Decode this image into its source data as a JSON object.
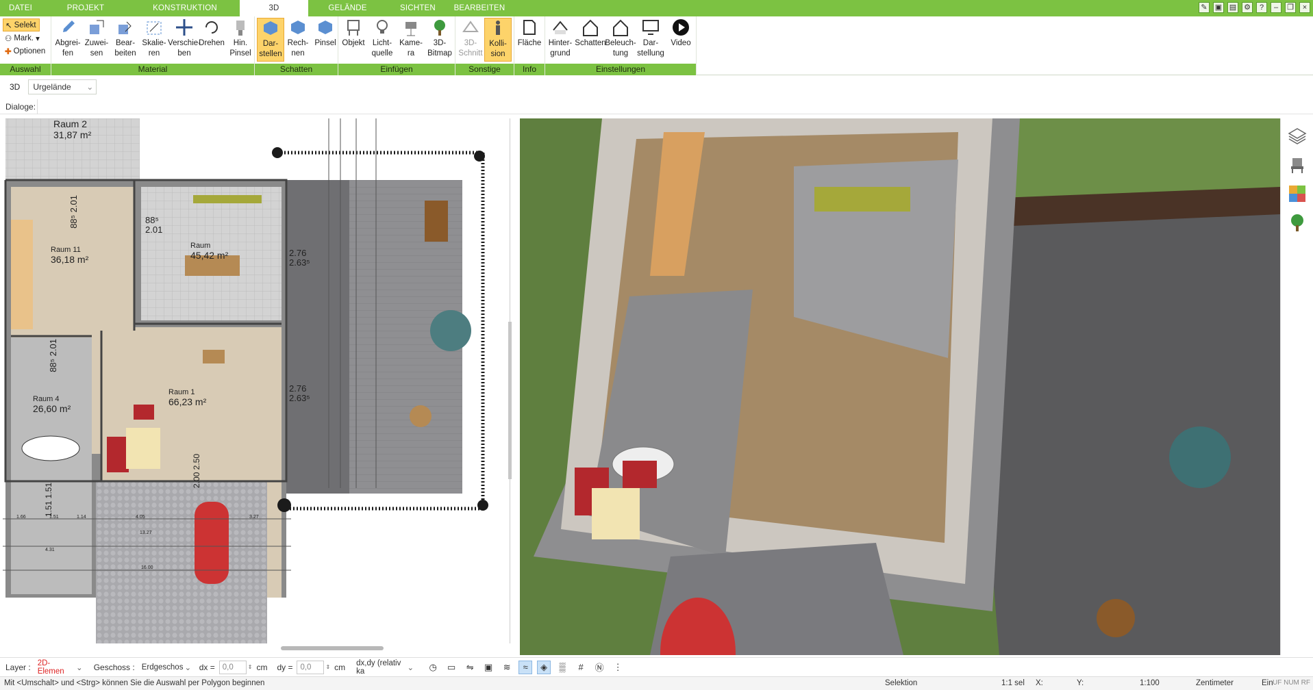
{
  "menu": {
    "tabs": [
      "DATEI",
      "PROJEKT",
      "KONSTRUKTION",
      "3D",
      "GELÄNDE",
      "SICHTEN",
      "BEARBEITEN"
    ],
    "active": "3D"
  },
  "ribbon": {
    "auswahl": {
      "label": "Auswahl",
      "selekt": "Selekt",
      "mark": "Mark.",
      "optionen": "Optionen"
    },
    "material": {
      "label": "Material",
      "buttons": [
        "Abgrei-\nfen",
        "Zuwei-\nsen",
        "Bear-\nbeiten",
        "Skalie-\nren",
        "Verschie-\nben",
        "Drehen",
        "Hin.\nPinsel"
      ]
    },
    "schatten": {
      "label": "Schatten",
      "buttons": [
        "Dar-\nstellen",
        "Rech-\nnen",
        "Pinsel"
      ]
    },
    "einfuegen": {
      "label": "Einfügen",
      "buttons": [
        "Objekt",
        "Licht-\nquelle",
        "Kame-\nra",
        "3D-\nBitmap"
      ]
    },
    "sonstige": {
      "label": "Sonstige",
      "buttons": [
        "3D-\nSchnitt",
        "Kolli-\nsion"
      ]
    },
    "info": {
      "label": "Info",
      "buttons": [
        "Fläche"
      ]
    },
    "einstellungen": {
      "label": "Einstellungen",
      "buttons": [
        "Hinter-\ngrund",
        "Schatten",
        "Beleuch-\ntung",
        "Dar-\nstellung",
        "Video"
      ]
    }
  },
  "toolbar": {
    "mode": "3D",
    "terrain": "Urgelände",
    "dialoge": "Dialoge:"
  },
  "plan": {
    "rooms": [
      {
        "name": "Raum 2",
        "area": "31,87 m²"
      },
      {
        "name": "Raum 11",
        "area": "36,18 m²"
      },
      {
        "name": "Raum",
        "area": "45,42 m²"
      },
      {
        "name": "Raum 4",
        "area": "26,60 m²"
      },
      {
        "name": "Raum 1",
        "area": "66,23 m²"
      }
    ],
    "dims": [
      "88⁵",
      "2.01",
      "88⁵",
      "2.01",
      "2.76",
      "2.63⁵",
      "88⁵",
      "2.01",
      "2.76",
      "2.63⁵",
      "2.00",
      "2.50",
      "1.51",
      "1.51"
    ],
    "bottom_dims": [
      "1.66",
      "1.51",
      "1.14",
      "4.05",
      "3.27",
      "13.27",
      "4.31",
      "16.00"
    ]
  },
  "bottom": {
    "layer_label": "Layer :",
    "layer_value": "2D-Elemen",
    "geschoss_label": "Geschoss :",
    "geschoss_value": "Erdgeschos",
    "dx_label": "dx =",
    "dx_value": "0,0",
    "dx_unit": "cm",
    "dy_label": "dy =",
    "dy_value": "0,0",
    "dy_unit": "cm",
    "mode_value": "dx,dy (relativ ka"
  },
  "status": {
    "hint": "Mit <Umschalt> und <Strg> können Sie die Auswahl per Polygon beginnen",
    "mode": "Selektion",
    "sel": "1:1 sel",
    "x": "X:",
    "y": "Y:",
    "scale": "1:100",
    "unit": "Zentimeter",
    "ein": "Ein",
    "flags": "UF NUM RF"
  },
  "colors": {
    "accent": "#7cc242",
    "highlight": "#fdd36a"
  }
}
